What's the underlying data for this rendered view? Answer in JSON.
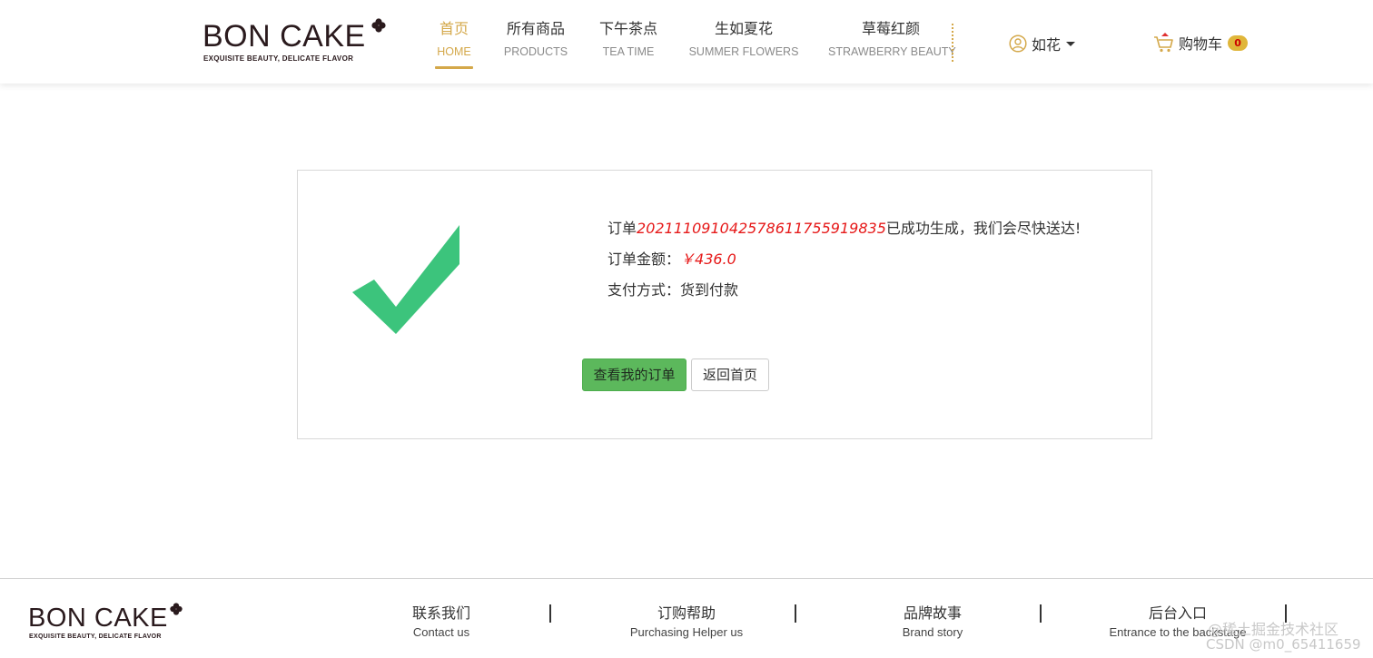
{
  "header": {
    "logo_main": "BON CAKE",
    "logo_sub": "EXQUISITE BEAUTY, DELICATE FLAVOR",
    "nav": [
      {
        "cn": "首页",
        "en": "HOME"
      },
      {
        "cn": "所有商品",
        "en": "PRODUCTS"
      },
      {
        "cn": "下午茶点",
        "en": "TEA TIME"
      },
      {
        "cn": "生如夏花",
        "en": "SUMMER FLOWERS"
      },
      {
        "cn": "草莓红颜",
        "en": "STRAWBERRY BEAUTY"
      }
    ],
    "active_index": 0,
    "user_name": "如花",
    "cart_label": "购物车",
    "cart_count": "0"
  },
  "order": {
    "prefix": "订单",
    "number": "20211109104257861175591983",
    "number_last": "5",
    "suffix": "已成功生成，我们会尽快送达!",
    "amount_label": "订单金额：",
    "amount_value": "￥436.0",
    "payment_label": "支付方式：",
    "payment_value": "货到付款"
  },
  "buttons": {
    "view_orders": "查看我的订单",
    "back_home": "返回首页"
  },
  "footer": {
    "logo_main": "BON CAKE",
    "logo_sub": "EXQUISITE BEAUTY, DELICATE FLAVOR",
    "columns": [
      {
        "cn": "联系我们",
        "en": "Contact us"
      },
      {
        "cn": "订购帮助",
        "en": "Purchasing Helper us"
      },
      {
        "cn": "品牌故事",
        "en": "Brand story"
      },
      {
        "cn": "后台入口",
        "en": "Entrance to the backstage"
      }
    ]
  },
  "watermark": {
    "line1": "@稀土掘金技术社区",
    "line2": "CSDN @m0_65411659"
  },
  "colors": {
    "accent": "#d4a84a",
    "check": "#3cc47c",
    "price": "#e61919",
    "primary_button": "#5cb85c"
  }
}
